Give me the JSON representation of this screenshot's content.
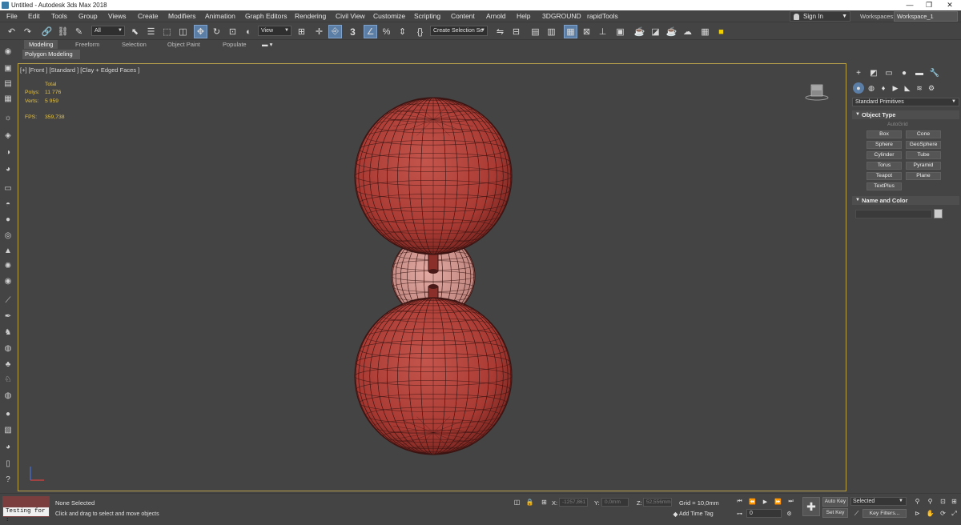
{
  "window": {
    "title": "Untitled - Autodesk 3ds Max 2018",
    "controls": [
      "—",
      "❐",
      "✕"
    ]
  },
  "menubar": {
    "items": [
      "File",
      "Edit",
      "Tools",
      "Group",
      "Views",
      "Create",
      "Modifiers",
      "Animation",
      "Graph Editors",
      "Rendering",
      "Civil View",
      "Customize",
      "Scripting",
      "Content",
      "Arnold",
      "Help",
      "3DGROUND",
      "rapidTools"
    ],
    "sign_in": "Sign In",
    "workspaces_label": "Workspaces:",
    "workspace_value": "Workspace_1"
  },
  "toolbar": {
    "selection_filter": "All",
    "ref_coord": "View",
    "named_selection": "Create Selection Se",
    "angle_snap_label": "3"
  },
  "ribbon": {
    "tabs": [
      "Modeling",
      "Freeform",
      "Selection",
      "Object Paint",
      "Populate"
    ],
    "active_sub": "Polygon Modeling"
  },
  "viewport": {
    "label": "[+] [Front ] [Standard ] [Clay + Edged Faces ]",
    "stats": {
      "total_label": "Total",
      "polys_label": "Polys:",
      "polys_value": "11 776",
      "verts_label": "Verts:",
      "verts_value": "5 959",
      "fps_label": "FPS:",
      "fps_value": "359,738"
    },
    "mesh_color": "#b8433d",
    "edge_color": "#3a1412"
  },
  "command_panel": {
    "category": "Standard Primitives",
    "object_type_title": "Object Type",
    "autogrid": "AutoGrid",
    "buttons": [
      "Box",
      "Cone",
      "Sphere",
      "GeoSphere",
      "Cylinder",
      "Tube",
      "Torus",
      "Pyramid",
      "Teapot",
      "Plane",
      "TextPlus"
    ],
    "name_color_title": "Name and Color"
  },
  "status": {
    "maxscript_text": "Testing for :",
    "selection": "None Selected",
    "prompt": "Click and drag to select and move objects",
    "x_label": "X:",
    "x_value": "-1257,861",
    "y_label": "Y:",
    "y_value": "0,0mm",
    "z_label": "Z:",
    "z_value": "52,556mm",
    "grid": "Grid = 10,0mm",
    "add_time_tag": "Add Time Tag",
    "frame": "0",
    "auto_key": "Auto Key",
    "set_key": "Set Key",
    "key_mode": "Selected",
    "key_filters": "Key Filters..."
  },
  "colors": {
    "viewport_border": "#b8a14a",
    "stats_text": "#e3c24a",
    "active_blue": "#5b7ea6"
  }
}
